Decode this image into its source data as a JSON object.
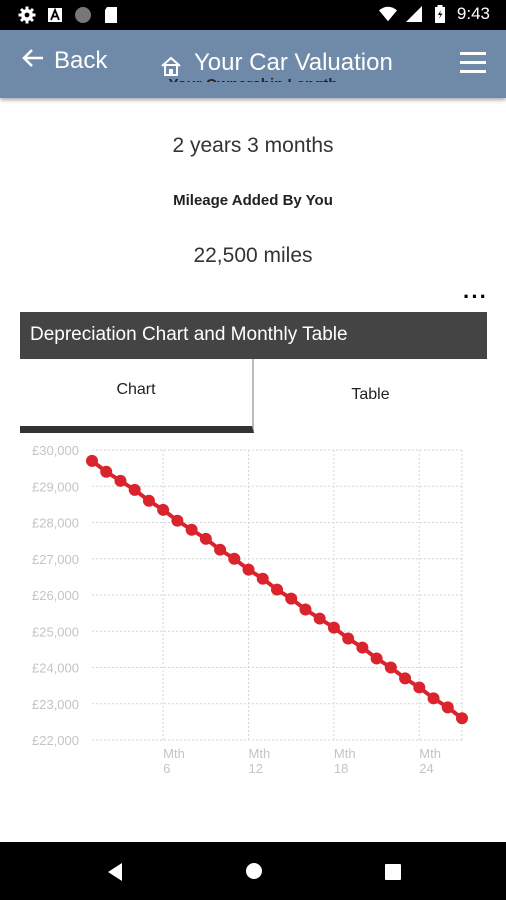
{
  "status_bar": {
    "time": "9:43"
  },
  "app_bar": {
    "back_label": "Back",
    "title": "Your Car Valuation"
  },
  "details": {
    "ownership_label": "Your Ownership Length",
    "ownership_value": "2 years 3 months",
    "mileage_label": "Mileage Added By You",
    "mileage_value": "22,500 miles"
  },
  "section": {
    "header": "Depreciation Chart and Monthly Table",
    "tabs": [
      {
        "label": "Chart",
        "active": true
      },
      {
        "label": "Table",
        "active": false
      }
    ]
  },
  "colors": {
    "app_bar": "#6f8aa9",
    "series": "#d9232d",
    "section_header": "#444444"
  },
  "chart_data": {
    "type": "line",
    "title": "",
    "xlabel": "",
    "ylabel": "",
    "ylim": [
      22000,
      30000
    ],
    "yticks": [
      "£30,000",
      "£29,000",
      "£28,000",
      "£27,000",
      "£26,000",
      "£25,000",
      "£24,000",
      "£23,000",
      "£22,000"
    ],
    "ytick_values": [
      30000,
      29000,
      28000,
      27000,
      26000,
      25000,
      24000,
      23000,
      22000
    ],
    "xticks": [
      {
        "month": 6,
        "label": [
          "Mth",
          "6"
        ]
      },
      {
        "month": 12,
        "label": [
          "Mth",
          "12"
        ]
      },
      {
        "month": 18,
        "label": [
          "Mth",
          "18"
        ]
      },
      {
        "month": 24,
        "label": [
          "Mth",
          "24"
        ]
      }
    ],
    "grid": true,
    "series": [
      {
        "x": [
          1,
          2,
          3,
          4,
          5,
          6,
          7,
          8,
          9,
          10,
          11,
          12,
          13,
          14,
          15,
          16,
          17,
          18,
          19,
          20,
          21,
          22,
          23,
          24,
          25,
          26,
          27
        ],
        "values": [
          29700,
          29400,
          29150,
          28900,
          28600,
          28350,
          28050,
          27800,
          27550,
          27250,
          27000,
          26700,
          26450,
          26150,
          25900,
          25600,
          25350,
          25100,
          24800,
          24550,
          24250,
          24000,
          23700,
          23450,
          23150,
          22900,
          22600
        ]
      }
    ]
  }
}
